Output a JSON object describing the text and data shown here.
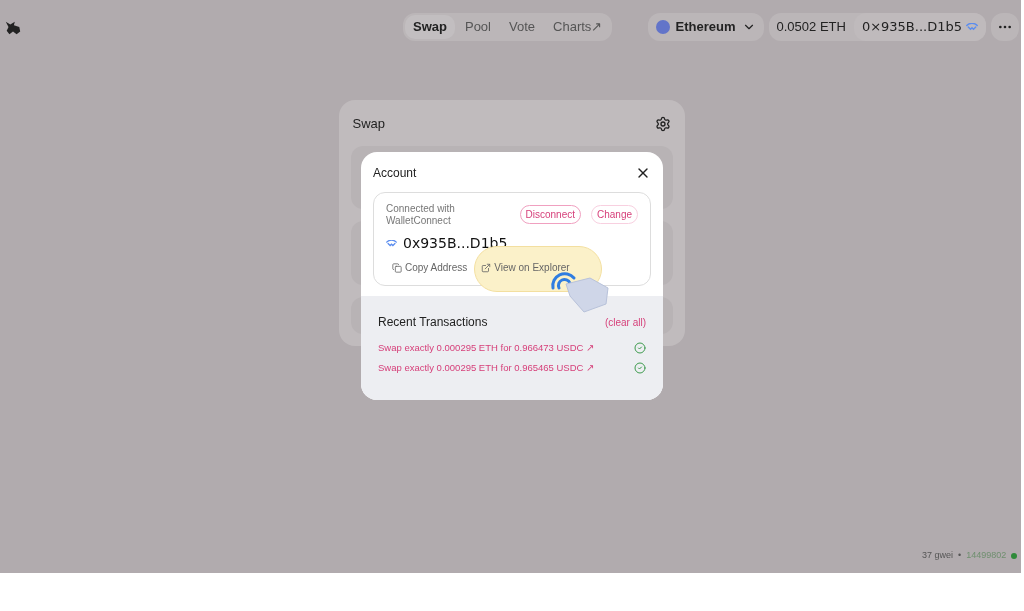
{
  "nav": {
    "tabs": [
      {
        "label": "Swap",
        "selected": true
      },
      {
        "label": "Pool",
        "selected": false
      },
      {
        "label": "Vote",
        "selected": false
      },
      {
        "label": "Charts↗",
        "selected": false
      }
    ]
  },
  "header": {
    "network": "Ethereum",
    "balance": "0.0502 ETH",
    "address": "0×935B...D1b5"
  },
  "swap_card": {
    "title": "Swap"
  },
  "account_modal": {
    "title": "Account",
    "connected_with": "Connected with WalletConnect",
    "disconnect": "Disconnect",
    "change": "Change",
    "address": "0x935B...D1b5",
    "copy_address": "Copy Address",
    "view_on_explorer": "View on Explorer",
    "recent_title": "Recent Transactions",
    "clear_all": "(clear all)",
    "transactions": [
      {
        "text": "Swap exactly 0.000295 ETH for 0.966473 USDC ↗",
        "confirmed": true
      },
      {
        "text": "Swap exactly 0.000295 ETH for 0.965465 USDC ↗",
        "confirmed": true
      }
    ]
  },
  "status": {
    "gas": "37 gwei",
    "separator": "•",
    "block": "14499802"
  }
}
